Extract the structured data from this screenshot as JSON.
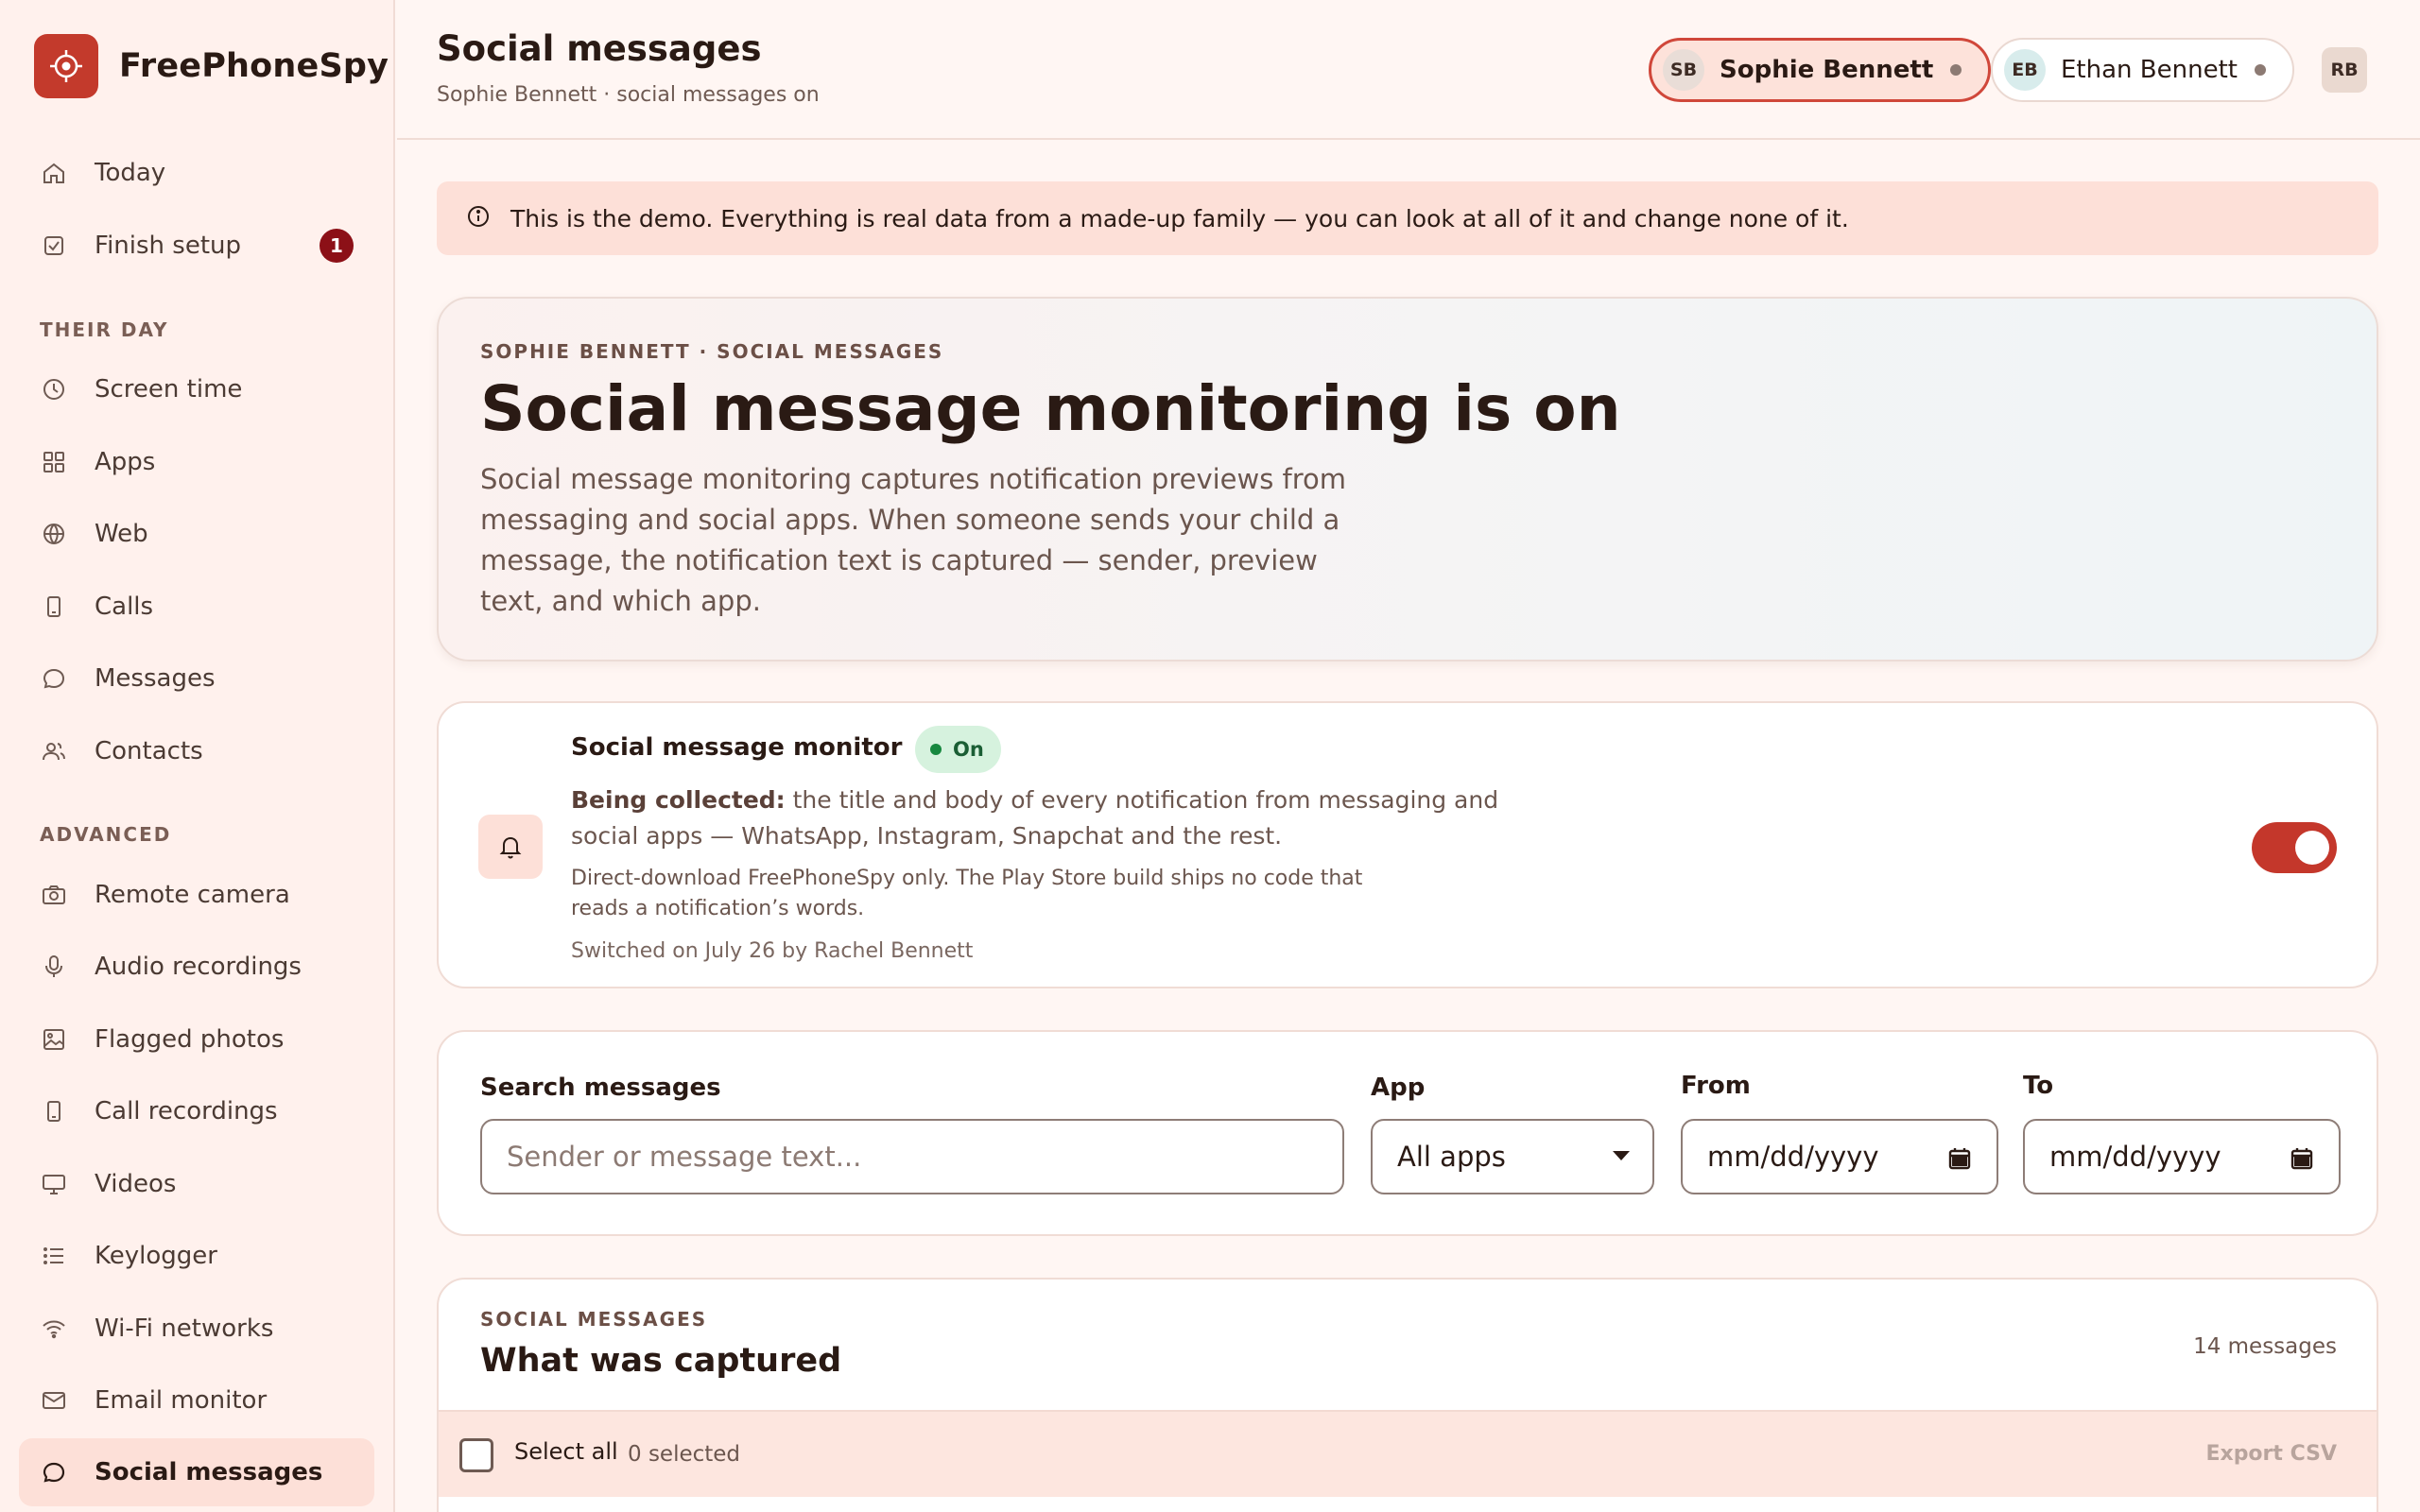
{
  "brand": {
    "name": "FreePhoneSpy"
  },
  "sidebar": {
    "top_items": [
      {
        "label": "Today",
        "icon": "home-icon"
      },
      {
        "label": "Finish setup",
        "icon": "checkbox-icon",
        "badge": "1"
      }
    ],
    "section_day": "THEIR DAY",
    "day_items": [
      {
        "label": "Screen time",
        "icon": "clock-icon"
      },
      {
        "label": "Apps",
        "icon": "grid-icon"
      },
      {
        "label": "Web",
        "icon": "globe-icon"
      },
      {
        "label": "Calls",
        "icon": "phone-icon"
      },
      {
        "label": "Messages",
        "icon": "chat-icon"
      },
      {
        "label": "Contacts",
        "icon": "users-icon"
      }
    ],
    "section_advanced": "ADVANCED",
    "advanced_items": [
      {
        "label": "Remote camera",
        "icon": "camera-icon"
      },
      {
        "label": "Audio recordings",
        "icon": "mic-icon"
      },
      {
        "label": "Flagged photos",
        "icon": "image-icon"
      },
      {
        "label": "Call recordings",
        "icon": "phone-icon"
      },
      {
        "label": "Videos",
        "icon": "monitor-icon"
      },
      {
        "label": "Keylogger",
        "icon": "list-icon"
      },
      {
        "label": "Wi-Fi networks",
        "icon": "wifi-icon"
      },
      {
        "label": "Email monitor",
        "icon": "mail-icon"
      },
      {
        "label": "Social messages",
        "icon": "chat-icon",
        "active": true
      }
    ]
  },
  "header": {
    "title": "Social messages",
    "subtitle": "Sophie Bennett · social messages on",
    "children": [
      {
        "initials": "SB",
        "name": "Sophie Bennett",
        "active": true
      },
      {
        "initials": "EB",
        "name": "Ethan Bennett",
        "active": false
      }
    ],
    "user_initials": "RB"
  },
  "banner": {
    "text": "This is the demo. Everything is real data from a made-up family — you can look at all of it and change none of it."
  },
  "hero": {
    "eyebrow": "SOPHIE BENNETT · SOCIAL MESSAGES",
    "title": "Social message monitoring is on",
    "description": "Social message monitoring captures notification previews from messaging and social apps. When someone sends your child a message, the notification text is captured — sender, preview text, and which app."
  },
  "monitor": {
    "title": "Social message monitor",
    "status": "On",
    "collected_label": "Being collected:",
    "collected_text": " the title and body of every notification from messaging and social apps — WhatsApp, Instagram, Snapchat and the rest.",
    "note": "Direct-download FreePhoneSpy only. The Play Store build ships no code that reads a notification’s words.",
    "switched": "Switched on July 26 by Rachel Bennett",
    "enabled": true
  },
  "filters": {
    "search_label": "Search messages",
    "search_placeholder": "Sender or message text...",
    "app_label": "App",
    "app_value": "All apps",
    "from_label": "From",
    "from_placeholder": "mm/dd/yyyy",
    "to_label": "To",
    "to_placeholder": "mm/dd/yyyy"
  },
  "captured": {
    "eyebrow": "SOCIAL MESSAGES",
    "title": "What was captured",
    "count": "14 messages",
    "select_all": "Select all",
    "selected": "0 selected",
    "export": "Export CSV"
  },
  "colors": {
    "accent": "#c33a2c",
    "badge": "#8c1017",
    "on": "#17883f"
  }
}
